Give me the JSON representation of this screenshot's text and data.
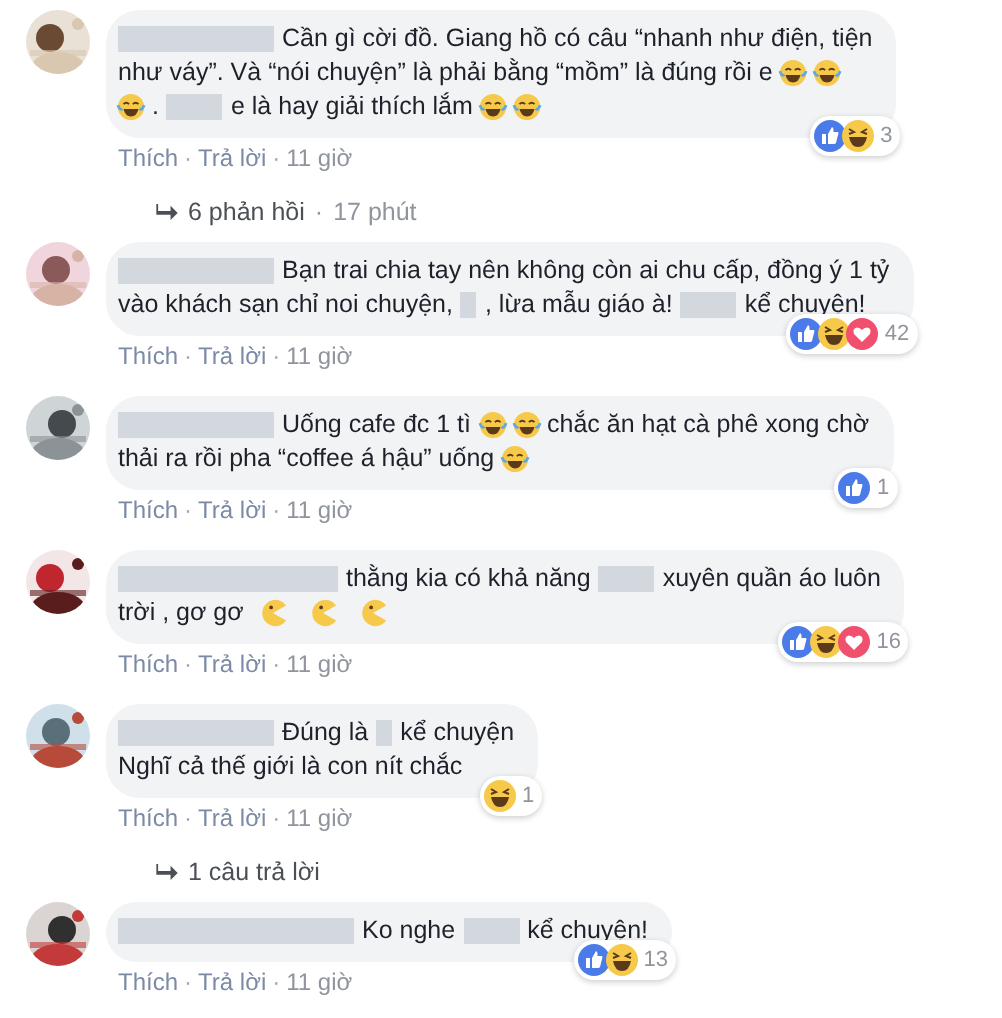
{
  "comments": [
    {
      "lines": [
        [
          {
            "kind": "redacted_long"
          },
          {
            "kind": "text",
            "text": "Cần gì cời đồ. Giang hồ có câu “nhanh như điện, tiện"
          }
        ],
        [
          {
            "kind": "text",
            "text": "như váy”. Và “nói chuyện” là phải bằng “mồm” là đúng rồi e"
          },
          {
            "kind": "joy"
          },
          {
            "kind": "joy"
          }
        ],
        [
          {
            "kind": "joy"
          },
          {
            "kind": "text",
            "text": "."
          },
          {
            "kind": "redacted_medium"
          },
          {
            "kind": "text",
            "text": "e là hay giải thích lắm"
          },
          {
            "kind": "joy"
          },
          {
            "kind": "joy"
          }
        ]
      ],
      "reactions": {
        "icons": [
          {
            "kind": "like"
          },
          {
            "kind": "haha"
          }
        ],
        "count": "3"
      },
      "meta": [
        {
          "kind": "link",
          "text": "Thích"
        },
        {
          "kind": "sep",
          "text": "·"
        },
        {
          "kind": "link",
          "text": "Trả lời"
        },
        {
          "kind": "sep",
          "text": "·"
        },
        {
          "kind": "time",
          "text": "11 giờ"
        }
      ],
      "replies": {
        "text": "6 phản hồi",
        "sep": "·",
        "time": "17 phút"
      }
    },
    {
      "lines": [
        [
          {
            "kind": "redacted_long"
          },
          {
            "kind": "text",
            "text": "Bạn trai chia tay nên không còn ai chu cấp, đồng ý 1 tỷ"
          }
        ],
        [
          {
            "kind": "text",
            "text": "vào khách sạn chỉ noi chuyện,"
          },
          {
            "kind": "redacted_short"
          },
          {
            "kind": "text",
            "text": ", lừa mẫu giáo à!"
          },
          {
            "kind": "redacted_medium"
          },
          {
            "kind": "text",
            "text": "kể chuyện!"
          }
        ]
      ],
      "reactions": {
        "icons": [
          {
            "kind": "like"
          },
          {
            "kind": "haha"
          },
          {
            "kind": "love"
          }
        ],
        "count": "42"
      },
      "meta": [
        {
          "kind": "link",
          "text": "Thích"
        },
        {
          "kind": "sep",
          "text": "·"
        },
        {
          "kind": "link",
          "text": "Trả lời"
        },
        {
          "kind": "sep",
          "text": "·"
        },
        {
          "kind": "time",
          "text": "11 giờ"
        }
      ]
    },
    {
      "lines": [
        [
          {
            "kind": "redacted_long"
          },
          {
            "kind": "text",
            "text": "Uống cafe đc 1 tì"
          },
          {
            "kind": "joy"
          },
          {
            "kind": "joy"
          },
          {
            "kind": "text",
            "text": "chắc ăn hạt cà phê xong chờ"
          }
        ],
        [
          {
            "kind": "text",
            "text": "thải ra rồi pha “coffee á hậu” uống"
          },
          {
            "kind": "joy"
          }
        ]
      ],
      "reactions": {
        "icons": [
          {
            "kind": "like"
          }
        ],
        "count": "1"
      },
      "meta": [
        {
          "kind": "link",
          "text": "Thích"
        },
        {
          "kind": "sep",
          "text": "·"
        },
        {
          "kind": "link",
          "text": "Trả lời"
        },
        {
          "kind": "sep",
          "text": "·"
        },
        {
          "kind": "time",
          "text": "11 giờ"
        }
      ]
    },
    {
      "lines": [
        [
          {
            "kind": "redacted_xlong"
          },
          {
            "kind": "text",
            "text": "thằng kia có khả năng"
          },
          {
            "kind": "redacted_medium"
          },
          {
            "kind": "text",
            "text": "xuyên quần áo luôn"
          }
        ],
        [
          {
            "kind": "text",
            "text": "trời , gơ gơ"
          },
          {
            "kind": "pacman"
          },
          {
            "kind": "pacman"
          },
          {
            "kind": "pacman"
          }
        ]
      ],
      "reactions": {
        "icons": [
          {
            "kind": "like"
          },
          {
            "kind": "haha"
          },
          {
            "kind": "love"
          }
        ],
        "count": "16"
      },
      "meta": [
        {
          "kind": "link",
          "text": "Thích"
        },
        {
          "kind": "sep",
          "text": "·"
        },
        {
          "kind": "link",
          "text": "Trả lời"
        },
        {
          "kind": "sep",
          "text": "·"
        },
        {
          "kind": "time",
          "text": "11 giờ"
        }
      ]
    },
    {
      "lines": [
        [
          {
            "kind": "redacted_long"
          },
          {
            "kind": "text",
            "text": "Đúng là"
          },
          {
            "kind": "redacted_short"
          },
          {
            "kind": "text",
            "text": "kể chuyện"
          }
        ],
        [
          {
            "kind": "text",
            "text": "Nghĩ cả thế giới là con nít chắc"
          }
        ]
      ],
      "reactions": {
        "icons": [
          {
            "kind": "haha"
          }
        ],
        "count": "1"
      },
      "meta": [
        {
          "kind": "link",
          "text": "Thích"
        },
        {
          "kind": "sep",
          "text": "·"
        },
        {
          "kind": "link",
          "text": "Trả lời"
        },
        {
          "kind": "sep",
          "text": "·"
        },
        {
          "kind": "time",
          "text": "11 giờ"
        }
      ],
      "replies": {
        "text": "1 câu trả lời"
      }
    },
    {
      "lines": [
        [
          {
            "kind": "redacted_xxlong"
          },
          {
            "kind": "text",
            "text": "Ko nghe"
          },
          {
            "kind": "redacted_medium"
          },
          {
            "kind": "text",
            "text": "kể chuyện!"
          }
        ]
      ],
      "reactions": {
        "icons": [
          {
            "kind": "like"
          },
          {
            "kind": "haha"
          }
        ],
        "count": "13"
      },
      "meta": [
        {
          "kind": "link",
          "text": "Thích"
        },
        {
          "kind": "sep",
          "text": "·"
        },
        {
          "kind": "link",
          "text": "Trả lời"
        },
        {
          "kind": "sep",
          "text": "·"
        },
        {
          "kind": "time",
          "text": "11 giờ"
        }
      ]
    }
  ]
}
